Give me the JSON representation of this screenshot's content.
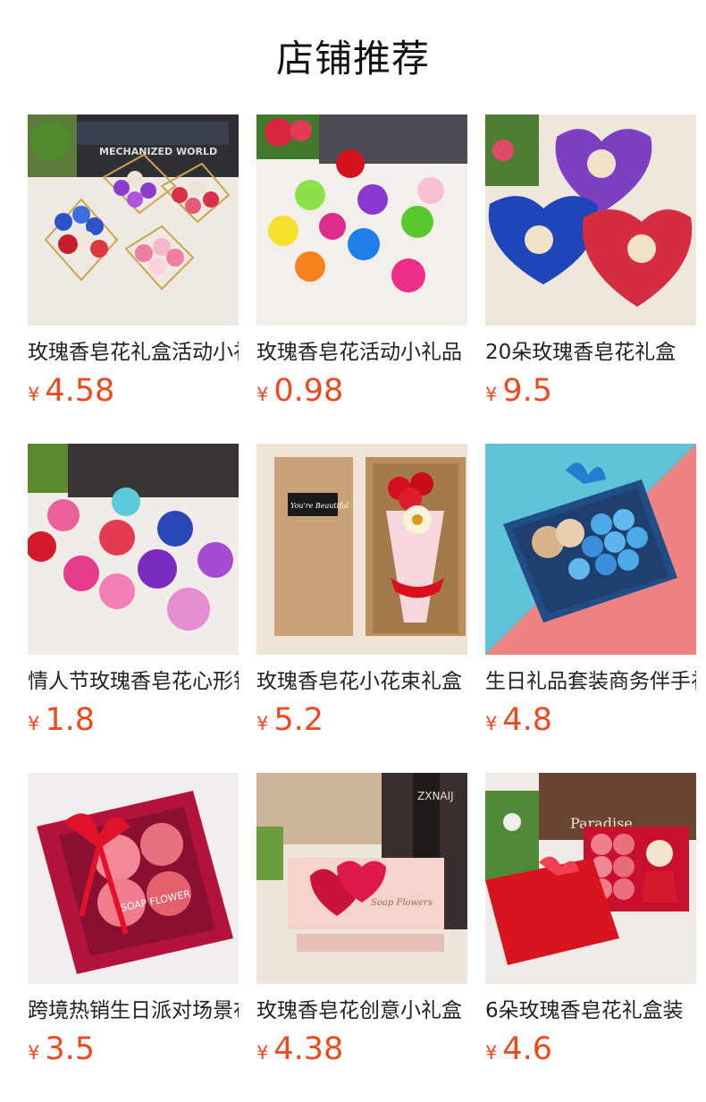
{
  "header": {
    "title": "店铺推荐"
  },
  "products": [
    {
      "name": "玫瑰香皂花礼盒活动小礼品",
      "currency": "¥",
      "price": "4.58",
      "icon": "heart-wire-basket-soap-roses-image"
    },
    {
      "name": "玫瑰香皂花活动小礼品",
      "currency": "¥",
      "price": "0.98",
      "icon": "colorful-heart-soap-roses-image"
    },
    {
      "name": "20朵玫瑰香皂花礼盒",
      "currency": "¥",
      "price": "9.5",
      "icon": "heart-box-soap-roses-bears-image"
    },
    {
      "name": "情人节玫瑰香皂花心形铁盒",
      "currency": "¥",
      "price": "1.8",
      "icon": "heart-tin-soap-roses-image"
    },
    {
      "name": "玫瑰香皂花小花束礼盒",
      "currency": "¥",
      "price": "5.2",
      "icon": "kraft-box-rose-bouquet-image"
    },
    {
      "name": "生日礼品套装商务伴手礼",
      "currency": "¥",
      "price": "4.8",
      "icon": "blue-box-bear-roses-image"
    },
    {
      "name": "跨境热销生日派对场景布置",
      "currency": "¥",
      "price": "3.5",
      "icon": "red-square-box-soap-roses-image"
    },
    {
      "name": "玫瑰香皂花创意小礼盒",
      "currency": "¥",
      "price": "4.38",
      "icon": "double-heart-window-box-image"
    },
    {
      "name": "6朵玫瑰香皂花礼盒装",
      "currency": "¥",
      "price": "4.6",
      "icon": "red-gift-box-bear-roses-image"
    }
  ],
  "colors": {
    "price": "#f0491e",
    "title": "#111111",
    "text": "#222222"
  },
  "image_texts": {
    "p1_book": "MECHANIZED WORLD",
    "p5_card": "You're Beautiful",
    "p7_lid": "SOAP FLOWER",
    "p8_lid": "Soap Flowers",
    "p8_book": "ZXNAIJ",
    "p9_box": "Paradise"
  }
}
